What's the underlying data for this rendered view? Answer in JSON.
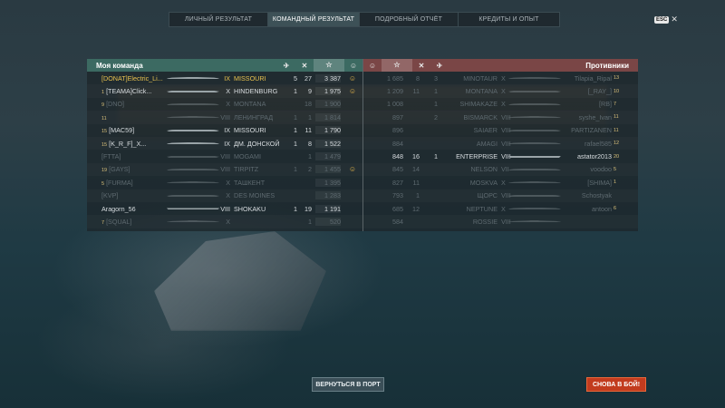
{
  "tabs": [
    {
      "label": "ЛИЧНЫЙ РЕЗУЛЬТАТ",
      "active": false
    },
    {
      "label": "КОМАНДНЫЙ РЕЗУЛЬТАТ",
      "active": true
    },
    {
      "label": "ПОДРОБНЫЙ ОТЧЁТ",
      "active": false
    },
    {
      "label": "КРЕДИТЫ И ОПЫТ",
      "active": false
    }
  ],
  "esc": {
    "key": "ESC",
    "close": "✕"
  },
  "my_team": {
    "title": "Моя команда",
    "header_icons": [
      "✈",
      "✕",
      "☆",
      "☺"
    ],
    "rows": [
      {
        "player": "[DONAT]Electric_Li...",
        "tier": "IX",
        "ship": "MISSOURI",
        "k1": "5",
        "k2": "27",
        "xp": "3 387",
        "em": "☺",
        "highlight": "gold",
        "dead": false
      },
      {
        "player": "[TEAMA]Click...",
        "div": "1",
        "tier": "X",
        "ship": "HINDENBURG",
        "k1": "1",
        "k2": "9",
        "xp": "1 975",
        "em": "☺",
        "dead": false
      },
      {
        "player": "[DNO]",
        "div": "9",
        "tier": "X",
        "ship": "MONTANA",
        "k1": "",
        "k2": "18",
        "xp": "1 900",
        "em": "",
        "dead": true
      },
      {
        "player": "",
        "div": "11",
        "tier": "VIII",
        "ship": "ЛЕНИНГРАД",
        "k1": "1",
        "k2": "1",
        "xp": "1 814",
        "em": "",
        "dead": true
      },
      {
        "player": "[MAC59]",
        "div": "15",
        "tier": "IX",
        "ship": "MISSOURI",
        "k1": "1",
        "k2": "11",
        "xp": "1 790",
        "em": "",
        "dead": false
      },
      {
        "player": "[K_R_F]_X...",
        "div": "15",
        "tier": "IX",
        "ship": "ДМ. ДОНСКОЙ",
        "k1": "1",
        "k2": "8",
        "xp": "1 522",
        "em": "",
        "dead": false
      },
      {
        "player": "[FTTA]",
        "tier": "VIII",
        "ship": "MOGAMI",
        "k1": "",
        "k2": "1",
        "xp": "1 479",
        "em": "",
        "dead": true
      },
      {
        "player": "[GAYS]",
        "div": "19",
        "tier": "VIII",
        "ship": "TIRPITZ",
        "k1": "1",
        "k2": "2",
        "xp": "1 455",
        "em": "☺",
        "dead": true
      },
      {
        "player": "[FURMA]",
        "div": "5",
        "tier": "X",
        "ship": "ТАШКЕНТ",
        "k1": "",
        "k2": "",
        "xp": "1 395",
        "em": "",
        "dead": true
      },
      {
        "player": "[KVP]",
        "tier": "X",
        "ship": "DES MOINES",
        "k1": "",
        "k2": "",
        "xp": "1 283",
        "em": "",
        "dead": true
      },
      {
        "player": "Aragorn_56",
        "tier": "VIII",
        "ship": "SHOKAKU",
        "k1": "1",
        "k2": "19",
        "xp": "1 191",
        "em": "",
        "dead": false
      },
      {
        "player": "[SQUAL]",
        "div": "7",
        "tier": "X",
        "ship": "",
        "k1": "",
        "k2": "1",
        "xp": "520",
        "em": "",
        "dead": true
      }
    ]
  },
  "enemy_team": {
    "title": "Противники",
    "header_icons": [
      "☺",
      "☆",
      "✕",
      "✈"
    ],
    "rows": [
      {
        "xp": "1 685",
        "k1": "8",
        "k2": "3",
        "ship": "MINOTAUR",
        "tier": "X",
        "player": "Tilapia_Ripal",
        "div": "13",
        "dead": true
      },
      {
        "xp": "1 209",
        "k1": "11",
        "k2": "1",
        "ship": "MONTANA",
        "tier": "X",
        "player": "[_RAY_]",
        "div": "10",
        "dead": true
      },
      {
        "xp": "1 008",
        "k1": "",
        "k2": "1",
        "ship": "SHIMAKAZE",
        "tier": "X",
        "player": "[RB]",
        "div": "7",
        "dead": true
      },
      {
        "xp": "897",
        "k1": "",
        "k2": "2",
        "ship": "BISMARCK",
        "tier": "VIII",
        "player": "syshe_Ivan",
        "div": "11",
        "dead": true
      },
      {
        "xp": "896",
        "k1": "",
        "k2": "",
        "ship": "SAIAER",
        "tier": "VIII",
        "player": "PARTIZANEN",
        "div": "11",
        "dead": true
      },
      {
        "xp": "884",
        "k1": "",
        "k2": "",
        "ship": "AMAGI",
        "tier": "VIII",
        "player": "rafael585",
        "div": "12",
        "dead": true
      },
      {
        "xp": "848",
        "k1": "16",
        "k2": "1",
        "ship": "ENTERPRISE",
        "tier": "VIII",
        "player": "astator2013",
        "div": "20",
        "dead": false
      },
      {
        "xp": "845",
        "k1": "14",
        "k2": "",
        "ship": "NELSON",
        "tier": "VII",
        "player": "voodoo",
        "div": "5",
        "dead": true
      },
      {
        "xp": "827",
        "k1": "11",
        "k2": "",
        "ship": "MOSKVA",
        "tier": "X",
        "player": "[SHIMA]",
        "div": "1",
        "dead": true
      },
      {
        "xp": "793",
        "k1": "1",
        "k2": "",
        "ship": "ЩОРС",
        "tier": "VIII",
        "player": "Schostyak",
        "div": "",
        "dead": true
      },
      {
        "xp": "685",
        "k1": "12",
        "k2": "",
        "ship": "NEPTUNE",
        "tier": "X",
        "player": "antoon",
        "div": "6",
        "dead": true
      },
      {
        "xp": "584",
        "k1": "",
        "k2": "",
        "ship": "ROSSIE",
        "tier": "VIII",
        "player": "",
        "div": "",
        "dead": true
      }
    ]
  },
  "buttons": {
    "port": "ВЕРНУТЬСЯ В ПОРТ",
    "battle": "СНОВА В БОЙ!"
  },
  "colors": {
    "my_team_header": "#3c6a62",
    "enemy_header": "#7a4646",
    "battle_button": "#c23b1e",
    "gold_text": "#e8c14e"
  }
}
